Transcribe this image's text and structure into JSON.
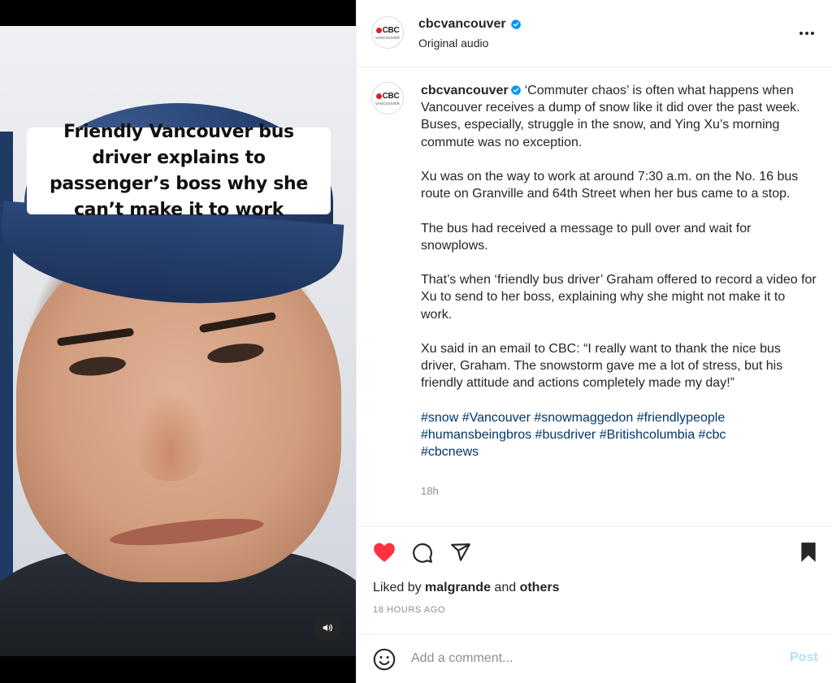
{
  "video": {
    "overlay_title": "Friendly Vancouver bus driver explains to passenger’s boss why she can’t make it to work",
    "mute_icon": "speaker-icon"
  },
  "account": {
    "username": "cbcvancouver",
    "avatar_brand": "CBC",
    "avatar_sub": "VANCOUVER",
    "audio_label": "Original audio"
  },
  "caption": {
    "username": "cbcvancouver",
    "paragraphs": [
      "‘Commuter chaos’ is often what happens when Vancouver receives a dump of snow like it did over the past week. Buses, especially, struggle in the snow, and Ying Xu’s morning commute was no exception.",
      "Xu was on the way to work at around 7:30 a.m. on the No. 16 bus route on Granville and 64th Street when her bus came to a stop.",
      "The bus had received a message to pull over and wait for snowplows.",
      "That’s when ‘friendly bus driver’ Graham offered to record a video for Xu to send to her boss, explaining why she might not make it to work.",
      "Xu said in an email to CBC: “I really want to thank the nice bus driver, Graham. The snowstorm gave me a lot of stress, but his friendly attitude and actions completely made my day!”"
    ],
    "hashtags": [
      "#snow",
      "#Vancouver",
      "#snowmaggedon",
      "#friendlypeople",
      "#humansbeingbros",
      "#busdriver",
      "#Britishcolumbia",
      "#cbc",
      "#cbcnews"
    ],
    "timestamp": "18h"
  },
  "actions": {
    "liked": true,
    "like_color": "#ff3040",
    "liked_by_prefix": "Liked by",
    "liked_by_user": "malgrande",
    "liked_by_and": "and",
    "liked_by_others": "others",
    "time_ago": "18 HOURS AGO"
  },
  "comment": {
    "placeholder": "Add a comment...",
    "post_label": "Post"
  },
  "colors": {
    "verified": "#0095f6",
    "hashtag": "#00376b",
    "post_disabled": "#b2dffc"
  }
}
